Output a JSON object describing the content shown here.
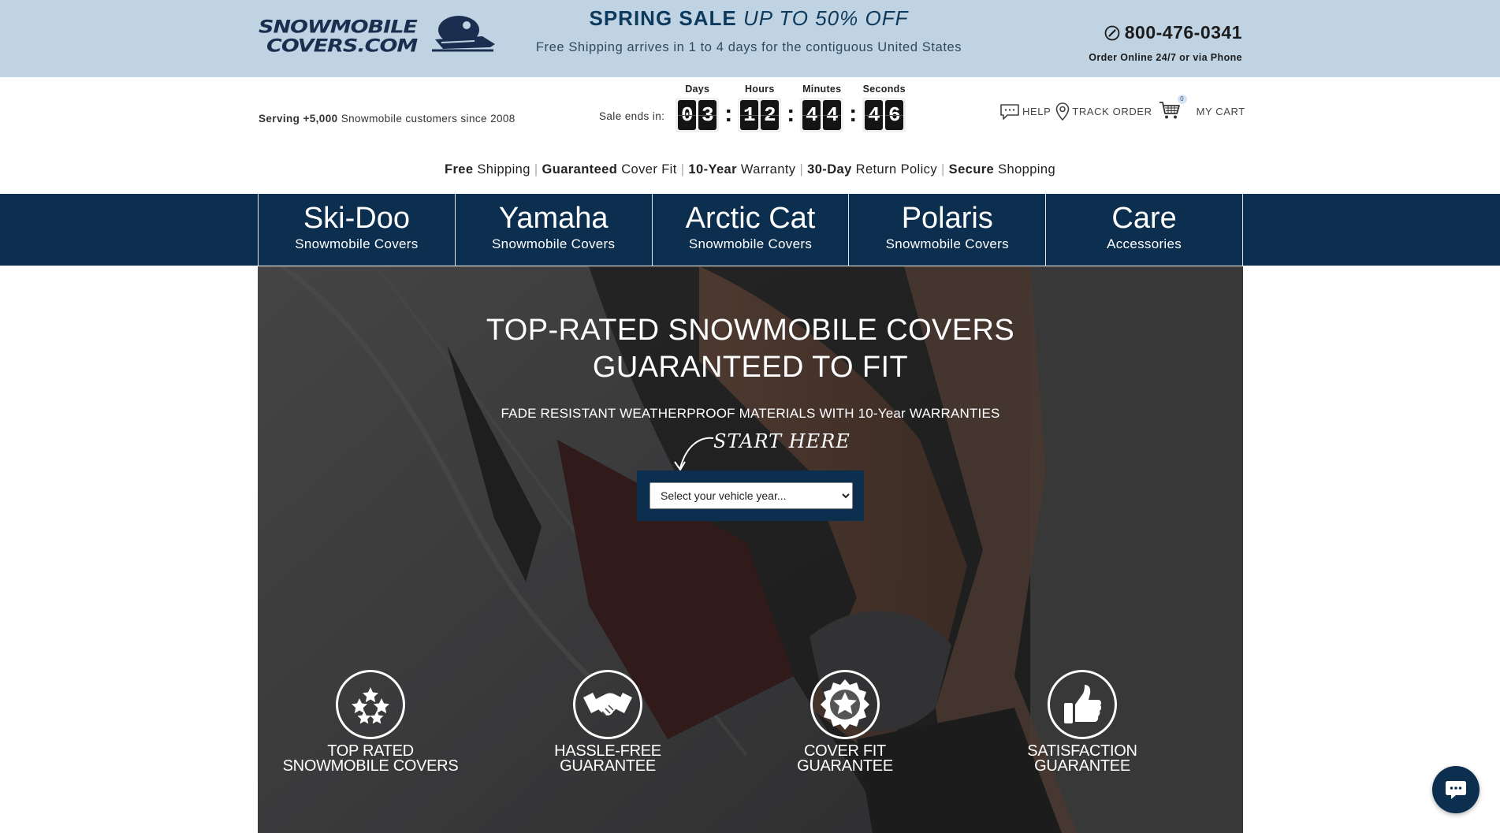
{
  "header": {
    "logo_line1": "SNOWMOBILE",
    "logo_line2": "COVERS.COM",
    "sale_bold": "SPRING SALE",
    "sale_italic": "UP TO 50% OFF",
    "shipping_note": "Free Shipping arrives in 1 to 4 days for the contiguous United States",
    "phone": "800-476-0341",
    "phone_note": "Order Online 24/7 or via Phone"
  },
  "subheader": {
    "serving_bold": "Serving +5,000",
    "serving_rest": " Snowmobile customers since 2008",
    "sale_ends_label": "Sale ends in:",
    "countdown": {
      "days_label": "Days",
      "days": [
        "0",
        "3"
      ],
      "hours_label": "Hours",
      "hours": [
        "1",
        "2"
      ],
      "minutes_label": "Minutes",
      "minutes": [
        "4",
        "4"
      ],
      "seconds_label": "Seconds",
      "seconds": [
        "4",
        "6"
      ]
    },
    "help_label": "HELP",
    "track_label": "TRACK ORDER",
    "cart_count": "0",
    "cart_label": "MY CART"
  },
  "perks": [
    {
      "bold": "Free",
      "rest": " Shipping"
    },
    {
      "bold": "Guaranteed",
      "rest": " Cover Fit"
    },
    {
      "bold": "10-Year",
      "rest": " Warranty"
    },
    {
      "bold": "30-Day",
      "rest": " Return Policy"
    },
    {
      "bold": "Secure",
      "rest": " Shopping"
    }
  ],
  "perk_separator": "|",
  "nav": [
    {
      "brand": "Ski-Doo",
      "sub": "Snowmobile Covers"
    },
    {
      "brand": "Yamaha",
      "sub": "Snowmobile Covers"
    },
    {
      "brand": "Arctic Cat",
      "sub": "Snowmobile Covers"
    },
    {
      "brand": "Polaris",
      "sub": "Snowmobile Covers"
    },
    {
      "brand": "Care",
      "sub": "Accessories"
    }
  ],
  "hero": {
    "title_line1": "TOP-RATED SNOWMOBILE COVERS",
    "title_line2": "GUARANTEED TO FIT",
    "subtitle": "FADE RESISTANT WEATHERPROOF MATERIALS WITH 10-Year WARRANTIES",
    "start_here": "START HERE",
    "year_select_placeholder": "Select your vehicle year..."
  },
  "badges": [
    {
      "icon": "stars-icon",
      "line1": "TOP RATED",
      "line2": "SNOWMOBILE COVERS"
    },
    {
      "icon": "handshake-icon",
      "line1": "HASSLE-FREE",
      "line2": "GUARANTEE"
    },
    {
      "icon": "star-seal-icon",
      "line1": "COVER FIT",
      "line2": "GUARANTEE"
    },
    {
      "icon": "thumbs-up-icon",
      "line1": "SATISFACTION",
      "line2": "GUARANTEE"
    }
  ],
  "colors": {
    "banner_bg": "#c0d3e3",
    "navy": "#0c2e4f",
    "white": "#ffffff"
  }
}
